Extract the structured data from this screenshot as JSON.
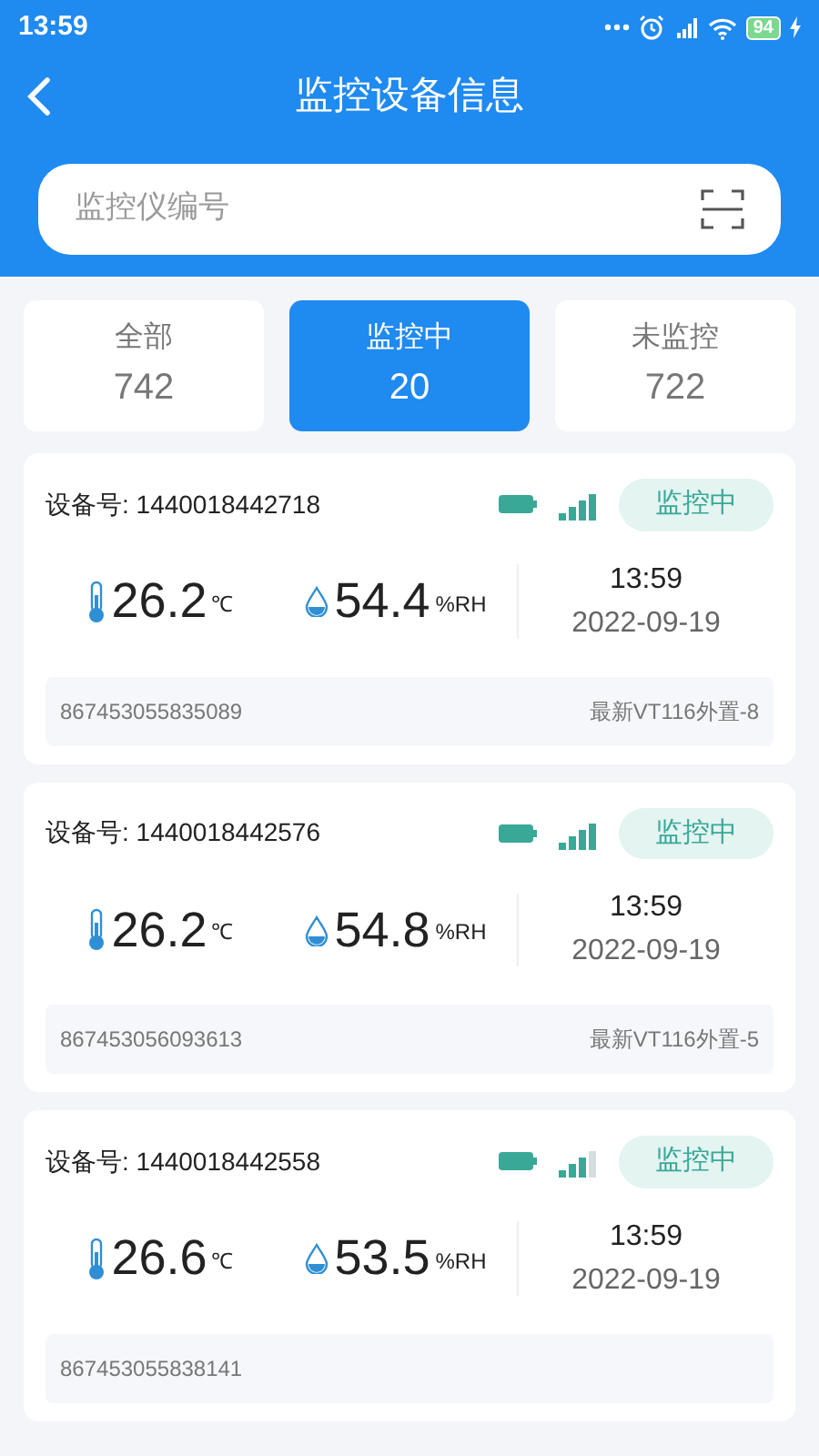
{
  "status_bar": {
    "time": "13:59",
    "battery": "94"
  },
  "header": {
    "title": "监控设备信息"
  },
  "search": {
    "placeholder": "监控仪编号"
  },
  "tabs": [
    {
      "label": "全部",
      "count": "742",
      "selected": false
    },
    {
      "label": "监控中",
      "count": "20",
      "selected": true
    },
    {
      "label": "未监控",
      "count": "722",
      "selected": false
    }
  ],
  "devices": [
    {
      "device_no": "设备号: 1440018442718",
      "signal_full": true,
      "status": "监控中",
      "temperature": "26.2",
      "temp_unit": "℃",
      "humidity": "54.4",
      "humidity_unit": "%RH",
      "time": "13:59",
      "date": "2022-09-19",
      "imei": "867453055835089",
      "model": "最新VT116外置-8"
    },
    {
      "device_no": "设备号: 1440018442576",
      "signal_full": true,
      "status": "监控中",
      "temperature": "26.2",
      "temp_unit": "℃",
      "humidity": "54.8",
      "humidity_unit": "%RH",
      "time": "13:59",
      "date": "2022-09-19",
      "imei": "867453056093613",
      "model": "最新VT116外置-5"
    },
    {
      "device_no": "设备号: 1440018442558",
      "signal_full": false,
      "status": "监控中",
      "temperature": "26.6",
      "temp_unit": "℃",
      "humidity": "53.5",
      "humidity_unit": "%RH",
      "time": "13:59",
      "date": "2022-09-19",
      "imei": "867453055838141"
    }
  ]
}
